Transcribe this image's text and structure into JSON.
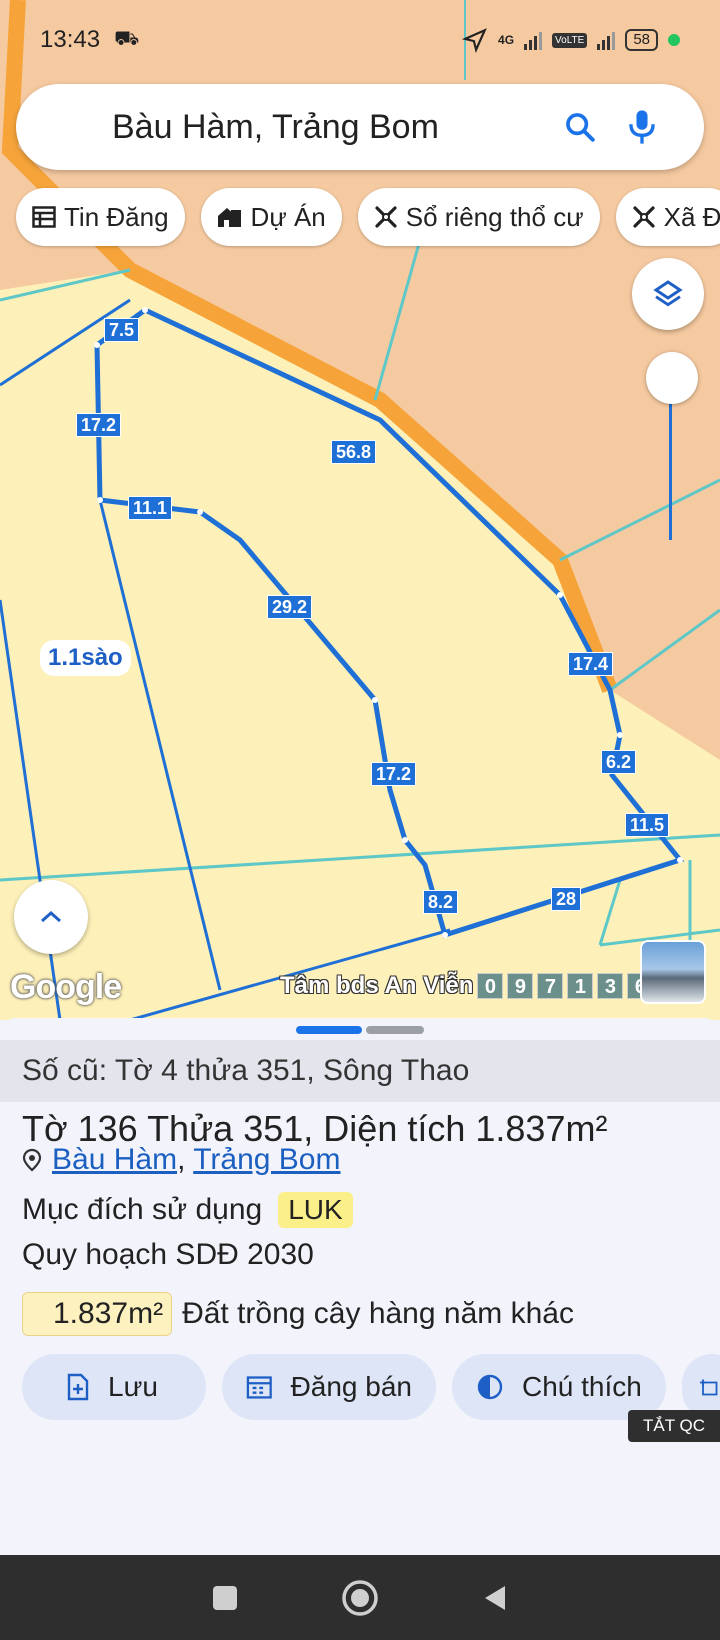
{
  "status_bar": {
    "time": "13:43",
    "network": "4G",
    "volte": "VoLTE",
    "battery": "58"
  },
  "search": {
    "query": "Bàu Hàm, Trảng Bom"
  },
  "chips": [
    {
      "label": "Tin Đăng",
      "icon": "table-icon"
    },
    {
      "label": "Dự Án",
      "icon": "house-icon"
    },
    {
      "label": "Sổ riêng thổ cư",
      "icon": "tools-icon"
    },
    {
      "label": "Xã Đ",
      "icon": "tools-icon"
    }
  ],
  "map": {
    "area_label": "1.1sào",
    "edge_labels": [
      "7.5",
      "17.2",
      "56.8",
      "11.1",
      "29.2",
      "17.4",
      "17.2",
      "6.2",
      "11.5",
      "8.2",
      "28"
    ],
    "google_logo": "Google",
    "watermark_text": "Tâm bds An Viễn",
    "watermark_digits": [
      "0",
      "9",
      "7",
      "1",
      "3",
      "6"
    ],
    "colors": {
      "residential": "#f6caa0",
      "parcel": "#fdf0b8",
      "road": "#f6a43a",
      "boundary": "#1e6fd6"
    }
  },
  "sheet": {
    "old_record": "Số cũ: Tờ 4 thửa 351, Sông Thao",
    "title": {
      "to_label": "Tờ",
      "to_value": "136",
      "thua_label": "Thửa",
      "thua_value": "351",
      "area_label": ", Diện tích",
      "area_value": "1.837m²"
    },
    "location": {
      "commune": "Bàu Hàm",
      "separator": ",",
      "district": "Trảng Bom"
    },
    "purpose_label": "Mục đích sử dụng",
    "purpose_code": "LUK",
    "plan_label": "Quy hoạch SDĐ 2030",
    "plan_area": "1.837m²",
    "plan_type": "Đất trồng cây hàng năm khác",
    "actions": [
      {
        "label": "Lưu",
        "icon": "file-plus-icon"
      },
      {
        "label": "Đăng bán",
        "icon": "calendar-icon"
      },
      {
        "label": "Chú thích",
        "icon": "half-circle-icon"
      }
    ],
    "ad_toggle": "TẮT QC"
  }
}
